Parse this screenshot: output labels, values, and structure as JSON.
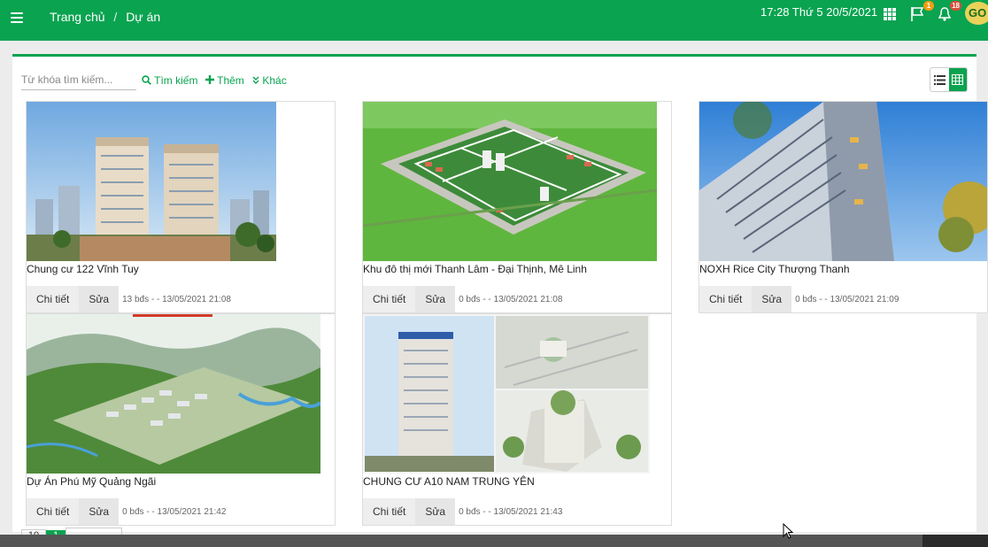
{
  "breadcrumb": {
    "home": "Trang chủ",
    "separator": "/",
    "current": "Dự án"
  },
  "header": {
    "clock": "17:28  Thứ 5 20/5/2021",
    "flag_count": "1",
    "bell_count": "18",
    "logo_text": "GO"
  },
  "toolbar": {
    "search_placeholder": "Từ khóa tìm kiếm...",
    "search_label": "Tìm kiếm",
    "add_label": "Thêm",
    "more_label": "Khác"
  },
  "colors": {
    "brand": "#0aa350",
    "flag_badge": "#f39c12",
    "bell_badge": "#dd4b39"
  },
  "projects": [
    {
      "title": "Chung cư 122 Vĩnh Tuy",
      "detail_label": "Chi tiết",
      "edit_label": "Sửa",
      "meta": "13 bđs - - 13/05/2021 21:08"
    },
    {
      "title": "Khu đô thị mới Thanh Lâm - Đại Thịnh, Mê Linh",
      "detail_label": "Chi tiết",
      "edit_label": "Sửa",
      "meta": "0 bđs - - 13/05/2021 21:08"
    },
    {
      "title": "NOXH Rice City Thượng Thanh",
      "detail_label": "Chi tiết",
      "edit_label": "Sửa",
      "meta": "0 bđs - - 13/05/2021 21:09"
    },
    {
      "title": "Dự Án Phú Mỹ Quảng Ngãi",
      "detail_label": "Chi tiết",
      "edit_label": "Sửa",
      "meta": "0 bđs - - 13/05/2021 21:42"
    },
    {
      "title": "CHUNG CƯ A10 NAM TRUNG YÊN",
      "detail_label": "Chi tiết",
      "edit_label": "Sửa",
      "meta": "0 bđs - - 13/05/2021 21:43"
    }
  ],
  "pagination": {
    "page_size": "10",
    "current_page": "1"
  }
}
